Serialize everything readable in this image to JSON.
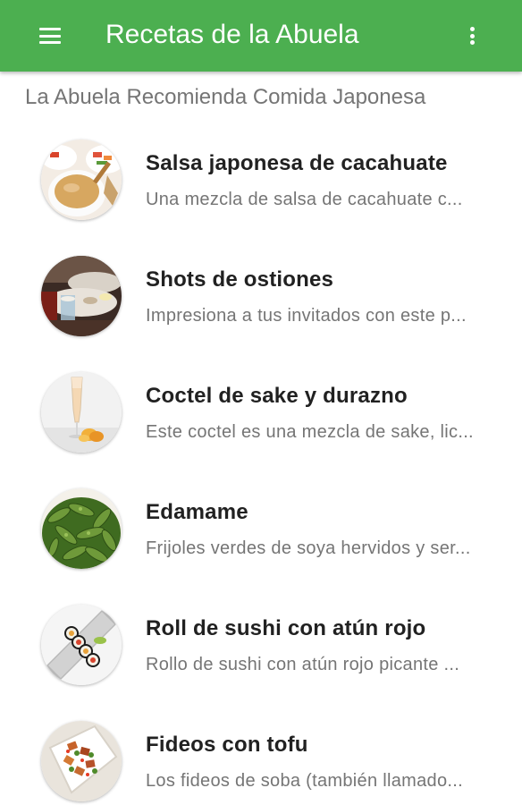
{
  "appbar": {
    "title": "Recetas de la Abuela",
    "color": "#4caf50",
    "menu_icon": "hamburger-menu-icon",
    "overflow_icon": "more-vert-icon"
  },
  "section": {
    "header": "La Abuela Recomienda Comida Japonesa"
  },
  "recipes": [
    {
      "title": "Salsa japonesa de cacahuate",
      "desc": "Una mezcla de salsa de cacahuate c...",
      "thumb": "peanut-sauce-photo"
    },
    {
      "title": "Shots de ostiones",
      "desc": "Impresiona a tus invitados con este p...",
      "thumb": "oyster-shots-photo"
    },
    {
      "title": "Coctel de sake y durazno",
      "desc": "Este coctel es una mezcla de sake, lic...",
      "thumb": "sake-peach-cocktail-photo"
    },
    {
      "title": "Edamame",
      "desc": "Frijoles verdes de soya hervidos y ser...",
      "thumb": "edamame-photo"
    },
    {
      "title": "Roll de sushi con atún rojo",
      "desc": "Rollo de sushi con atún rojo picante ...",
      "thumb": "tuna-sushi-roll-photo"
    },
    {
      "title": "Fideos con tofu",
      "desc": "Los fideos de soba (también llamado...",
      "thumb": "tofu-noodles-photo"
    }
  ]
}
